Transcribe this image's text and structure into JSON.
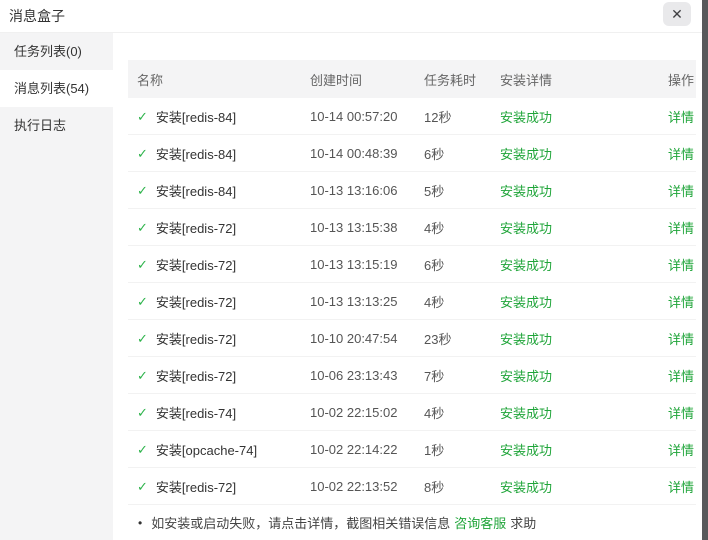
{
  "dialog": {
    "title": "消息盒子",
    "close_icon": "✕"
  },
  "sidebar": {
    "items": [
      {
        "label": "任务列表(0)"
      },
      {
        "label": "消息列表(54)"
      },
      {
        "label": "执行日志"
      }
    ],
    "active_index": 1
  },
  "table": {
    "columns": [
      "名称",
      "创建时间",
      "任务耗时",
      "安装详情",
      "操作"
    ],
    "check_icon": "✓",
    "rows": [
      {
        "name": "安装[redis-84]",
        "created": "10-14 00:57:20",
        "duration": "12秒",
        "status": "安装成功",
        "action": "详情"
      },
      {
        "name": "安装[redis-84]",
        "created": "10-14 00:48:39",
        "duration": "6秒",
        "status": "安装成功",
        "action": "详情"
      },
      {
        "name": "安装[redis-84]",
        "created": "10-13 13:16:06",
        "duration": "5秒",
        "status": "安装成功",
        "action": "详情"
      },
      {
        "name": "安装[redis-72]",
        "created": "10-13 13:15:38",
        "duration": "4秒",
        "status": "安装成功",
        "action": "详情"
      },
      {
        "name": "安装[redis-72]",
        "created": "10-13 13:15:19",
        "duration": "6秒",
        "status": "安装成功",
        "action": "详情"
      },
      {
        "name": "安装[redis-72]",
        "created": "10-13 13:13:25",
        "duration": "4秒",
        "status": "安装成功",
        "action": "详情"
      },
      {
        "name": "安装[redis-72]",
        "created": "10-10 20:47:54",
        "duration": "23秒",
        "status": "安装成功",
        "action": "详情"
      },
      {
        "name": "安装[redis-72]",
        "created": "10-06 23:13:43",
        "duration": "7秒",
        "status": "安装成功",
        "action": "详情"
      },
      {
        "name": "安装[redis-74]",
        "created": "10-02 22:15:02",
        "duration": "4秒",
        "status": "安装成功",
        "action": "详情"
      },
      {
        "name": "安装[opcache-74]",
        "created": "10-02 22:14:22",
        "duration": "1秒",
        "status": "安装成功",
        "action": "详情"
      },
      {
        "name": "安装[redis-72]",
        "created": "10-02 22:13:52",
        "duration": "8秒",
        "status": "安装成功",
        "action": "详情"
      }
    ]
  },
  "footer": {
    "bullet": "•",
    "note": "如安装或启动失败，请点击详情，截图相关错误信息",
    "link_label": "咨询客服",
    "suffix": "求助"
  },
  "colors": {
    "green": "#20a53a",
    "check_green": "#2cb34a",
    "sidebar_bg": "#f4f4f5"
  }
}
